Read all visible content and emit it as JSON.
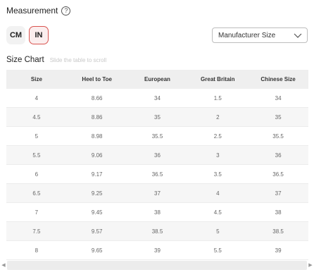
{
  "measurement": {
    "title": "Measurement",
    "help_glyph": "?"
  },
  "units": {
    "cm_label": "CM",
    "in_label": "IN",
    "selected": "IN"
  },
  "size_select": {
    "value": "Manufacturer Size"
  },
  "size_chart": {
    "title": "Size Chart",
    "hint": "Slide the table to scroll",
    "columns": [
      "Size",
      "Heel to Toe",
      "European",
      "Great Britain",
      "Chinese Size"
    ],
    "rows": [
      [
        "4",
        "8.66",
        "34",
        "1.5",
        "34"
      ],
      [
        "4.5",
        "8.86",
        "35",
        "2",
        "35"
      ],
      [
        "5",
        "8.98",
        "35.5",
        "2.5",
        "35.5"
      ],
      [
        "5.5",
        "9.06",
        "36",
        "3",
        "36"
      ],
      [
        "6",
        "9.17",
        "36.5",
        "3.5",
        "36.5"
      ],
      [
        "6.5",
        "9.25",
        "37",
        "4",
        "37"
      ],
      [
        "7",
        "9.45",
        "38",
        "4.5",
        "38"
      ],
      [
        "7.5",
        "9.57",
        "38.5",
        "5",
        "38.5"
      ],
      [
        "8",
        "9.65",
        "39",
        "5.5",
        "39"
      ]
    ]
  },
  "scrollbar": {
    "left_arrow": "◀",
    "right_arrow": "▶"
  },
  "colors": {
    "accent": "#d9534f"
  }
}
